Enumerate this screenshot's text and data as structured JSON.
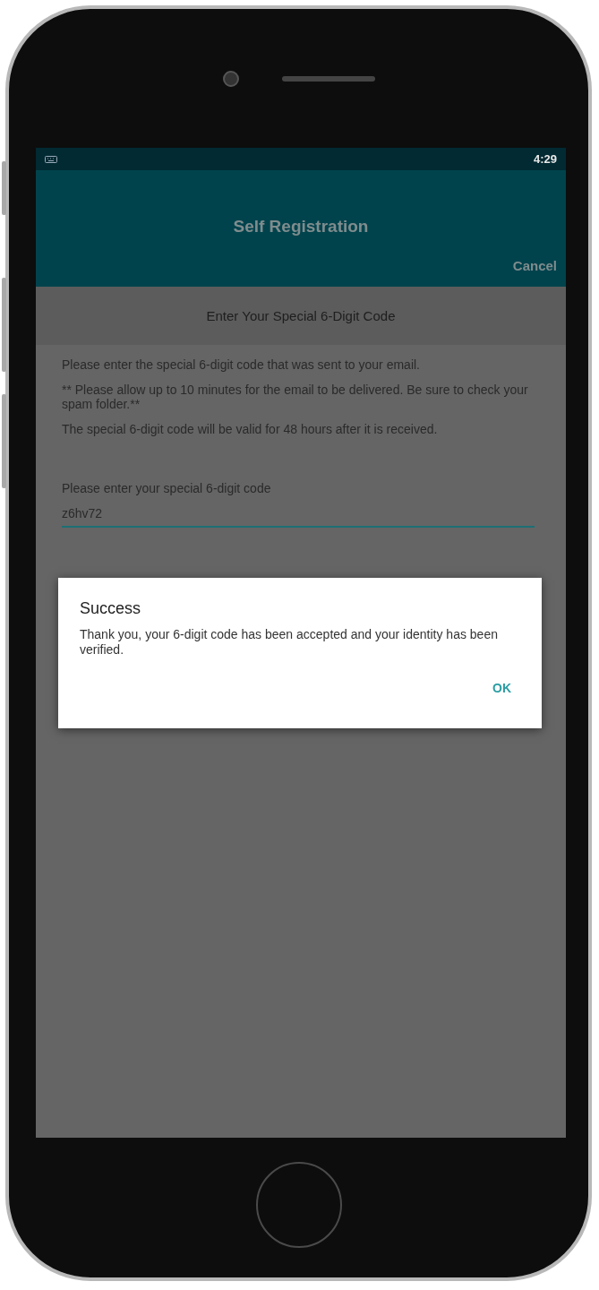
{
  "status_bar": {
    "time": "4:29"
  },
  "app_bar": {
    "title": "Self Registration",
    "action": "Cancel"
  },
  "section_header": "Enter Your Special 6-Digit Code",
  "instructions": [
    "Please enter the special 6-digit code that was sent to your email.",
    "** Please allow up to 10 minutes for the email to be delivered. Be sure to check your spam folder.**",
    "The special 6-digit code will be valid for 48 hours after it is received."
  ],
  "code_field": {
    "label": "Please enter your special 6-digit code",
    "value": "z6hv72"
  },
  "dialog": {
    "title": "Success",
    "message": "Thank you, your 6-digit code has been accepted and your identity has been verified.",
    "button": "OK"
  }
}
